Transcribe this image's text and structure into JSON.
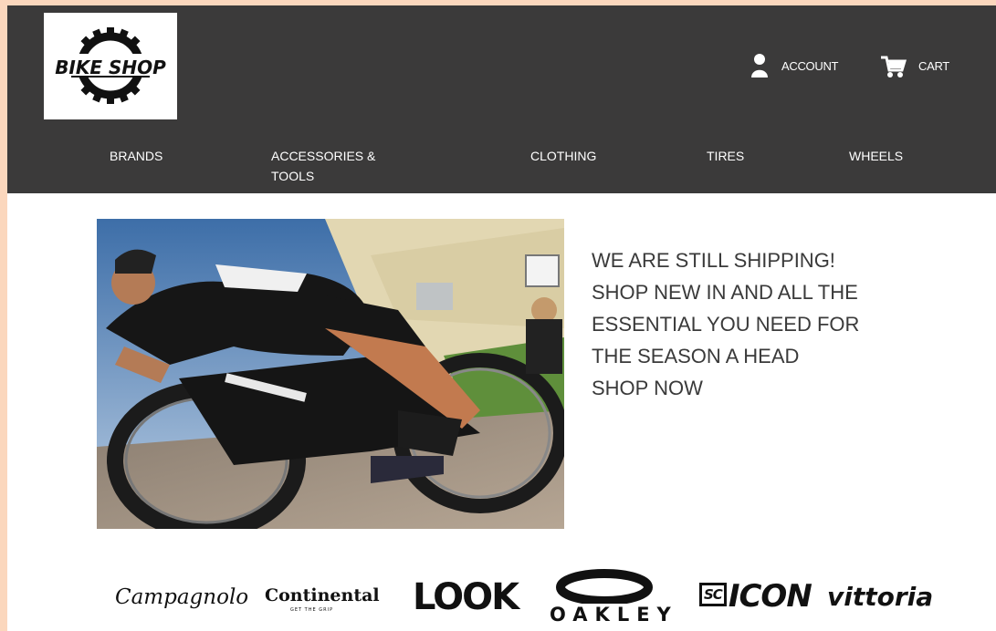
{
  "header": {
    "logo_text": "BIKE SHOP",
    "account_label": "ACCOUNT",
    "cart_label": "CART"
  },
  "nav": {
    "items": [
      {
        "label": "BRANDS"
      },
      {
        "label": "ACCESSORIES & TOOLS"
      },
      {
        "label": "CLOTHING"
      },
      {
        "label": "TIRES"
      },
      {
        "label": "WHEELS"
      }
    ]
  },
  "promo": {
    "lines": [
      "WE ARE STILL SHIPPING!",
      "SHOP NEW IN AND ALL THE",
      "ESSENTIAL YOU NEED FOR",
      "THE SEASON A HEAD"
    ],
    "cta": "SHOP NOW"
  },
  "brands": {
    "campagnolo": "Campagnolo",
    "continental": "Continental",
    "continental_tagline": "GET THE GRIP",
    "look": "LOOK",
    "oakley": "OAKLEY",
    "icon_prefix": "SC",
    "icon": "ICON",
    "vittoria": "vittoria"
  },
  "icons": {
    "account": "user-icon",
    "cart": "cart-icon"
  },
  "colors": {
    "page_background": "#fbd7bd",
    "header_background": "#3b3a3a",
    "text_light": "#ffffff",
    "promo_text": "#3a3a3a"
  }
}
